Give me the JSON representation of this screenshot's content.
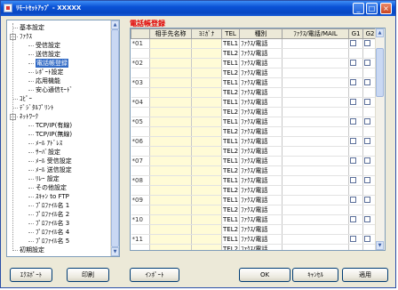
{
  "window": {
    "title": "ﾘﾓｰﾄｾｯﾄｱｯﾌﾟ - XXXXX"
  },
  "tree": {
    "items": [
      {
        "label": "基本設定",
        "level": 0,
        "selected": false
      },
      {
        "label": "ﾌｧｸｽ",
        "level": 0,
        "selected": false,
        "expanded": true
      },
      {
        "label": "受信設定",
        "level": 1,
        "selected": false
      },
      {
        "label": "送信設定",
        "level": 1,
        "selected": false
      },
      {
        "label": "電話帳登録",
        "level": 1,
        "selected": true
      },
      {
        "label": "ﾚﾎﾟｰﾄ設定",
        "level": 1,
        "selected": false
      },
      {
        "label": "応用機能",
        "level": 1,
        "selected": false
      },
      {
        "label": "安心通信ﾓｰﾄﾞ",
        "level": 1,
        "selected": false
      },
      {
        "label": "ｺﾋﾟｰ",
        "level": 0,
        "selected": false
      },
      {
        "label": "ﾃﾞｼﾞﾀﾙﾌﾟﾘﾝﾄ",
        "level": 0,
        "selected": false
      },
      {
        "label": "ﾈｯﾄﾜｰｸ",
        "level": 0,
        "selected": false,
        "expanded": true
      },
      {
        "label": "TCP/IP(有線)",
        "level": 1,
        "selected": false
      },
      {
        "label": "TCP/IP(無線)",
        "level": 1,
        "selected": false
      },
      {
        "label": "ﾒｰﾙ ｱﾄﾞﾚｽ",
        "level": 1,
        "selected": false
      },
      {
        "label": "ｻｰﾊﾞ設定",
        "level": 1,
        "selected": false
      },
      {
        "label": "ﾒｰﾙ 受信設定",
        "level": 1,
        "selected": false
      },
      {
        "label": "ﾒｰﾙ 送信設定",
        "level": 1,
        "selected": false
      },
      {
        "label": "ﾘﾚｰ 設定",
        "level": 1,
        "selected": false
      },
      {
        "label": "その他設定",
        "level": 1,
        "selected": false
      },
      {
        "label": "ｽｷｬﾝ to FTP",
        "level": 1,
        "selected": false
      },
      {
        "label": "ﾌﾟﾛﾌｧｲﾙ名 1",
        "level": 1,
        "selected": false
      },
      {
        "label": "ﾌﾟﾛﾌｧｲﾙ名 2",
        "level": 1,
        "selected": false
      },
      {
        "label": "ﾌﾟﾛﾌｧｲﾙ名 3",
        "level": 1,
        "selected": false
      },
      {
        "label": "ﾌﾟﾛﾌｧｲﾙ名 4",
        "level": 1,
        "selected": false
      },
      {
        "label": "ﾌﾟﾛﾌｧｲﾙ名 5",
        "level": 1,
        "selected": false
      },
      {
        "label": "初期設定",
        "level": 0,
        "selected": false
      }
    ]
  },
  "panel": {
    "title": "電話帳登録"
  },
  "grid": {
    "columns": [
      "",
      "相手先名称",
      "ﾖﾐｶﾞﾅ",
      "TEL",
      "種別",
      "ﾌｧｸｽ/電話/MAIL",
      "G1",
      "G2"
    ],
    "tel_labels": [
      "TEL1",
      "TEL2"
    ],
    "kind": "ﾌｧｸｽ/電話",
    "entries": [
      "*01",
      "*02",
      "*03",
      "*04",
      "*05",
      "*06",
      "*07",
      "*08",
      "*09",
      "*10",
      "*11",
      "*12"
    ]
  },
  "buttons": {
    "export": "ｴｸｽﾎﾟｰﾄ",
    "print": "印刷",
    "import": "ｲﾝﾎﾟｰﾄ",
    "ok": "OK",
    "cancel": "ｷｬﾝｾﾙ",
    "apply": "適用"
  },
  "colors": {
    "title_red": "#e00000",
    "selection": "#316ac5",
    "titlebar": "#0a52d6"
  }
}
